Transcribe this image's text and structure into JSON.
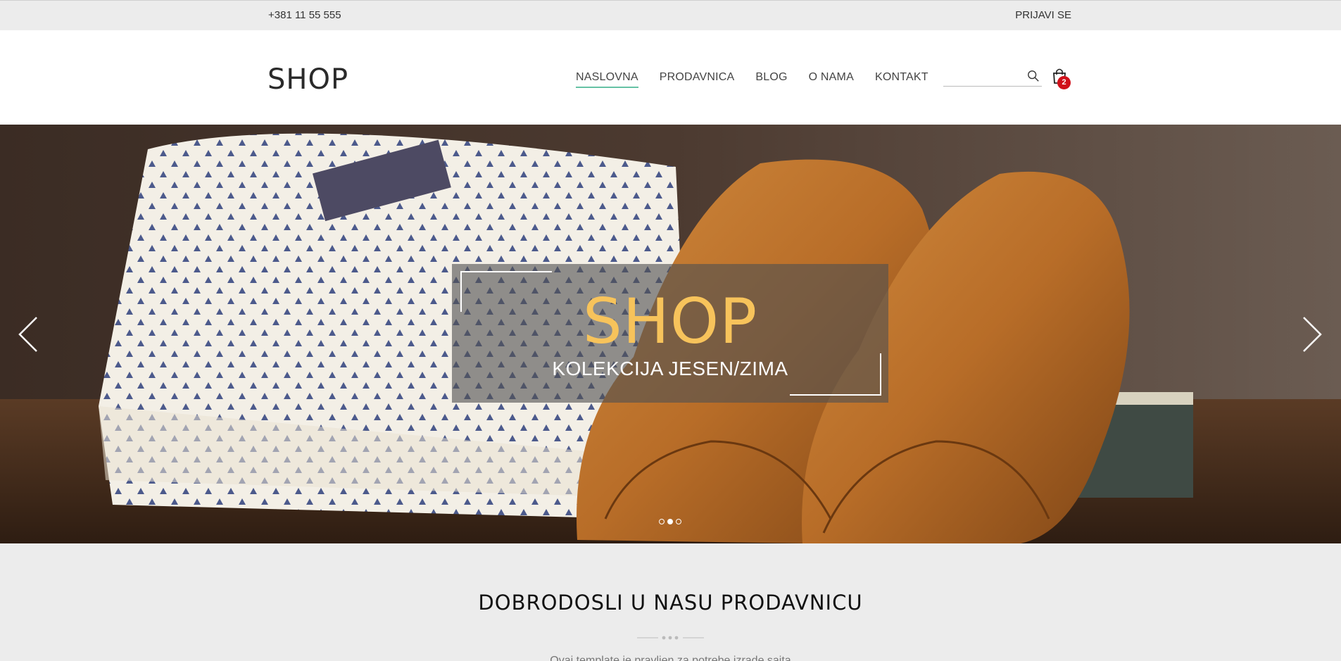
{
  "topbar": {
    "phone": "+381 11 55 555",
    "login": "PRIJAVI SE"
  },
  "header": {
    "logo": "SHOP",
    "nav": [
      {
        "label": "NASLOVNA",
        "active": true
      },
      {
        "label": "PRODAVNICA"
      },
      {
        "label": "BLOG"
      },
      {
        "label": "O NAMA"
      },
      {
        "label": "KONTAKT"
      }
    ],
    "search": {
      "value": "",
      "placeholder": ""
    },
    "cart": {
      "count": "2"
    }
  },
  "hero": {
    "title": "SHOP",
    "subtitle": "KOLEKCIJA JESEN/ZIMA",
    "slides": 3,
    "active_slide": 1
  },
  "welcome": {
    "heading": "DOBRODOSLI U NASU PRODAVNICU",
    "intro": "Ovaj template je pravljen za potrebe izrade sajta"
  },
  "colors": {
    "accent": "#66c2a5",
    "hero_title": "#f7c35b",
    "badge": "#d0101a"
  }
}
